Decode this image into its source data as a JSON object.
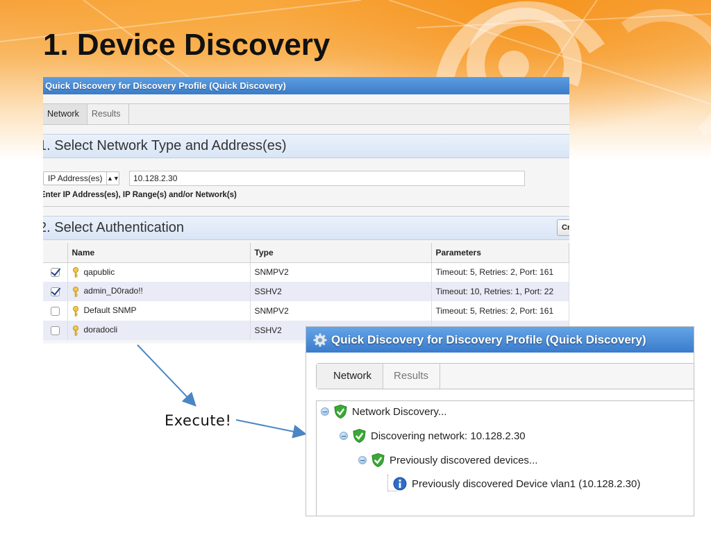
{
  "slide": {
    "title": "1. Device Discovery",
    "annotation": "Execute!"
  },
  "panel1": {
    "title": "Quick Discovery for Discovery Profile (Quick Discovery)",
    "tabs": [
      {
        "label": "Network",
        "active": true
      },
      {
        "label": "Results",
        "active": false
      }
    ],
    "section1": {
      "title": "1. Select Network Type and Address(es)",
      "type_select": "IP Address(es)",
      "address_value": "10.128.2.30",
      "hint": "Enter IP Address(es), IP Range(s) and/or Network(s)"
    },
    "section2": {
      "title": "2. Select Authentication",
      "create_button": "Cr",
      "columns": [
        "Name",
        "Type",
        "Parameters"
      ],
      "rows": [
        {
          "checked": true,
          "name": "qapublic",
          "type": "SNMPV2",
          "parameters": "Timeout: 5, Retries: 2, Port: 161"
        },
        {
          "checked": true,
          "name": "admin_D0rado!!",
          "type": "SSHV2",
          "parameters": "Timeout: 10, Retries: 1, Port: 22"
        },
        {
          "checked": false,
          "name": "Default SNMP",
          "type": "SNMPV2",
          "parameters": "Timeout: 5, Retries: 2, Port: 161"
        },
        {
          "checked": false,
          "name": "doradocli",
          "type": "SSHV2",
          "parameters": ""
        }
      ]
    }
  },
  "panel2": {
    "title": "Quick Discovery for Discovery Profile (Quick Discovery)",
    "tabs": [
      {
        "label": "Network",
        "active": true
      },
      {
        "label": "Results",
        "active": false
      }
    ],
    "tree": [
      {
        "label": "Network Discovery...",
        "icon": "shield-check-icon",
        "level": 0
      },
      {
        "label": "Discovering network: 10.128.2.30",
        "icon": "shield-check-icon",
        "level": 1
      },
      {
        "label": "Previously discovered devices...",
        "icon": "shield-check-icon",
        "level": 2
      },
      {
        "label": "Previously discovered Device vlan1 (10.128.2.30)",
        "icon": "info-icon",
        "level": 3
      }
    ]
  },
  "colors": {
    "title_bar": "#3a7cc9",
    "section_band": "#d9e5f6",
    "row_alt": "#e9ecf7",
    "accent_orange": "#f6941e",
    "arrow": "#4a86c5",
    "shield": "#3aa935"
  }
}
